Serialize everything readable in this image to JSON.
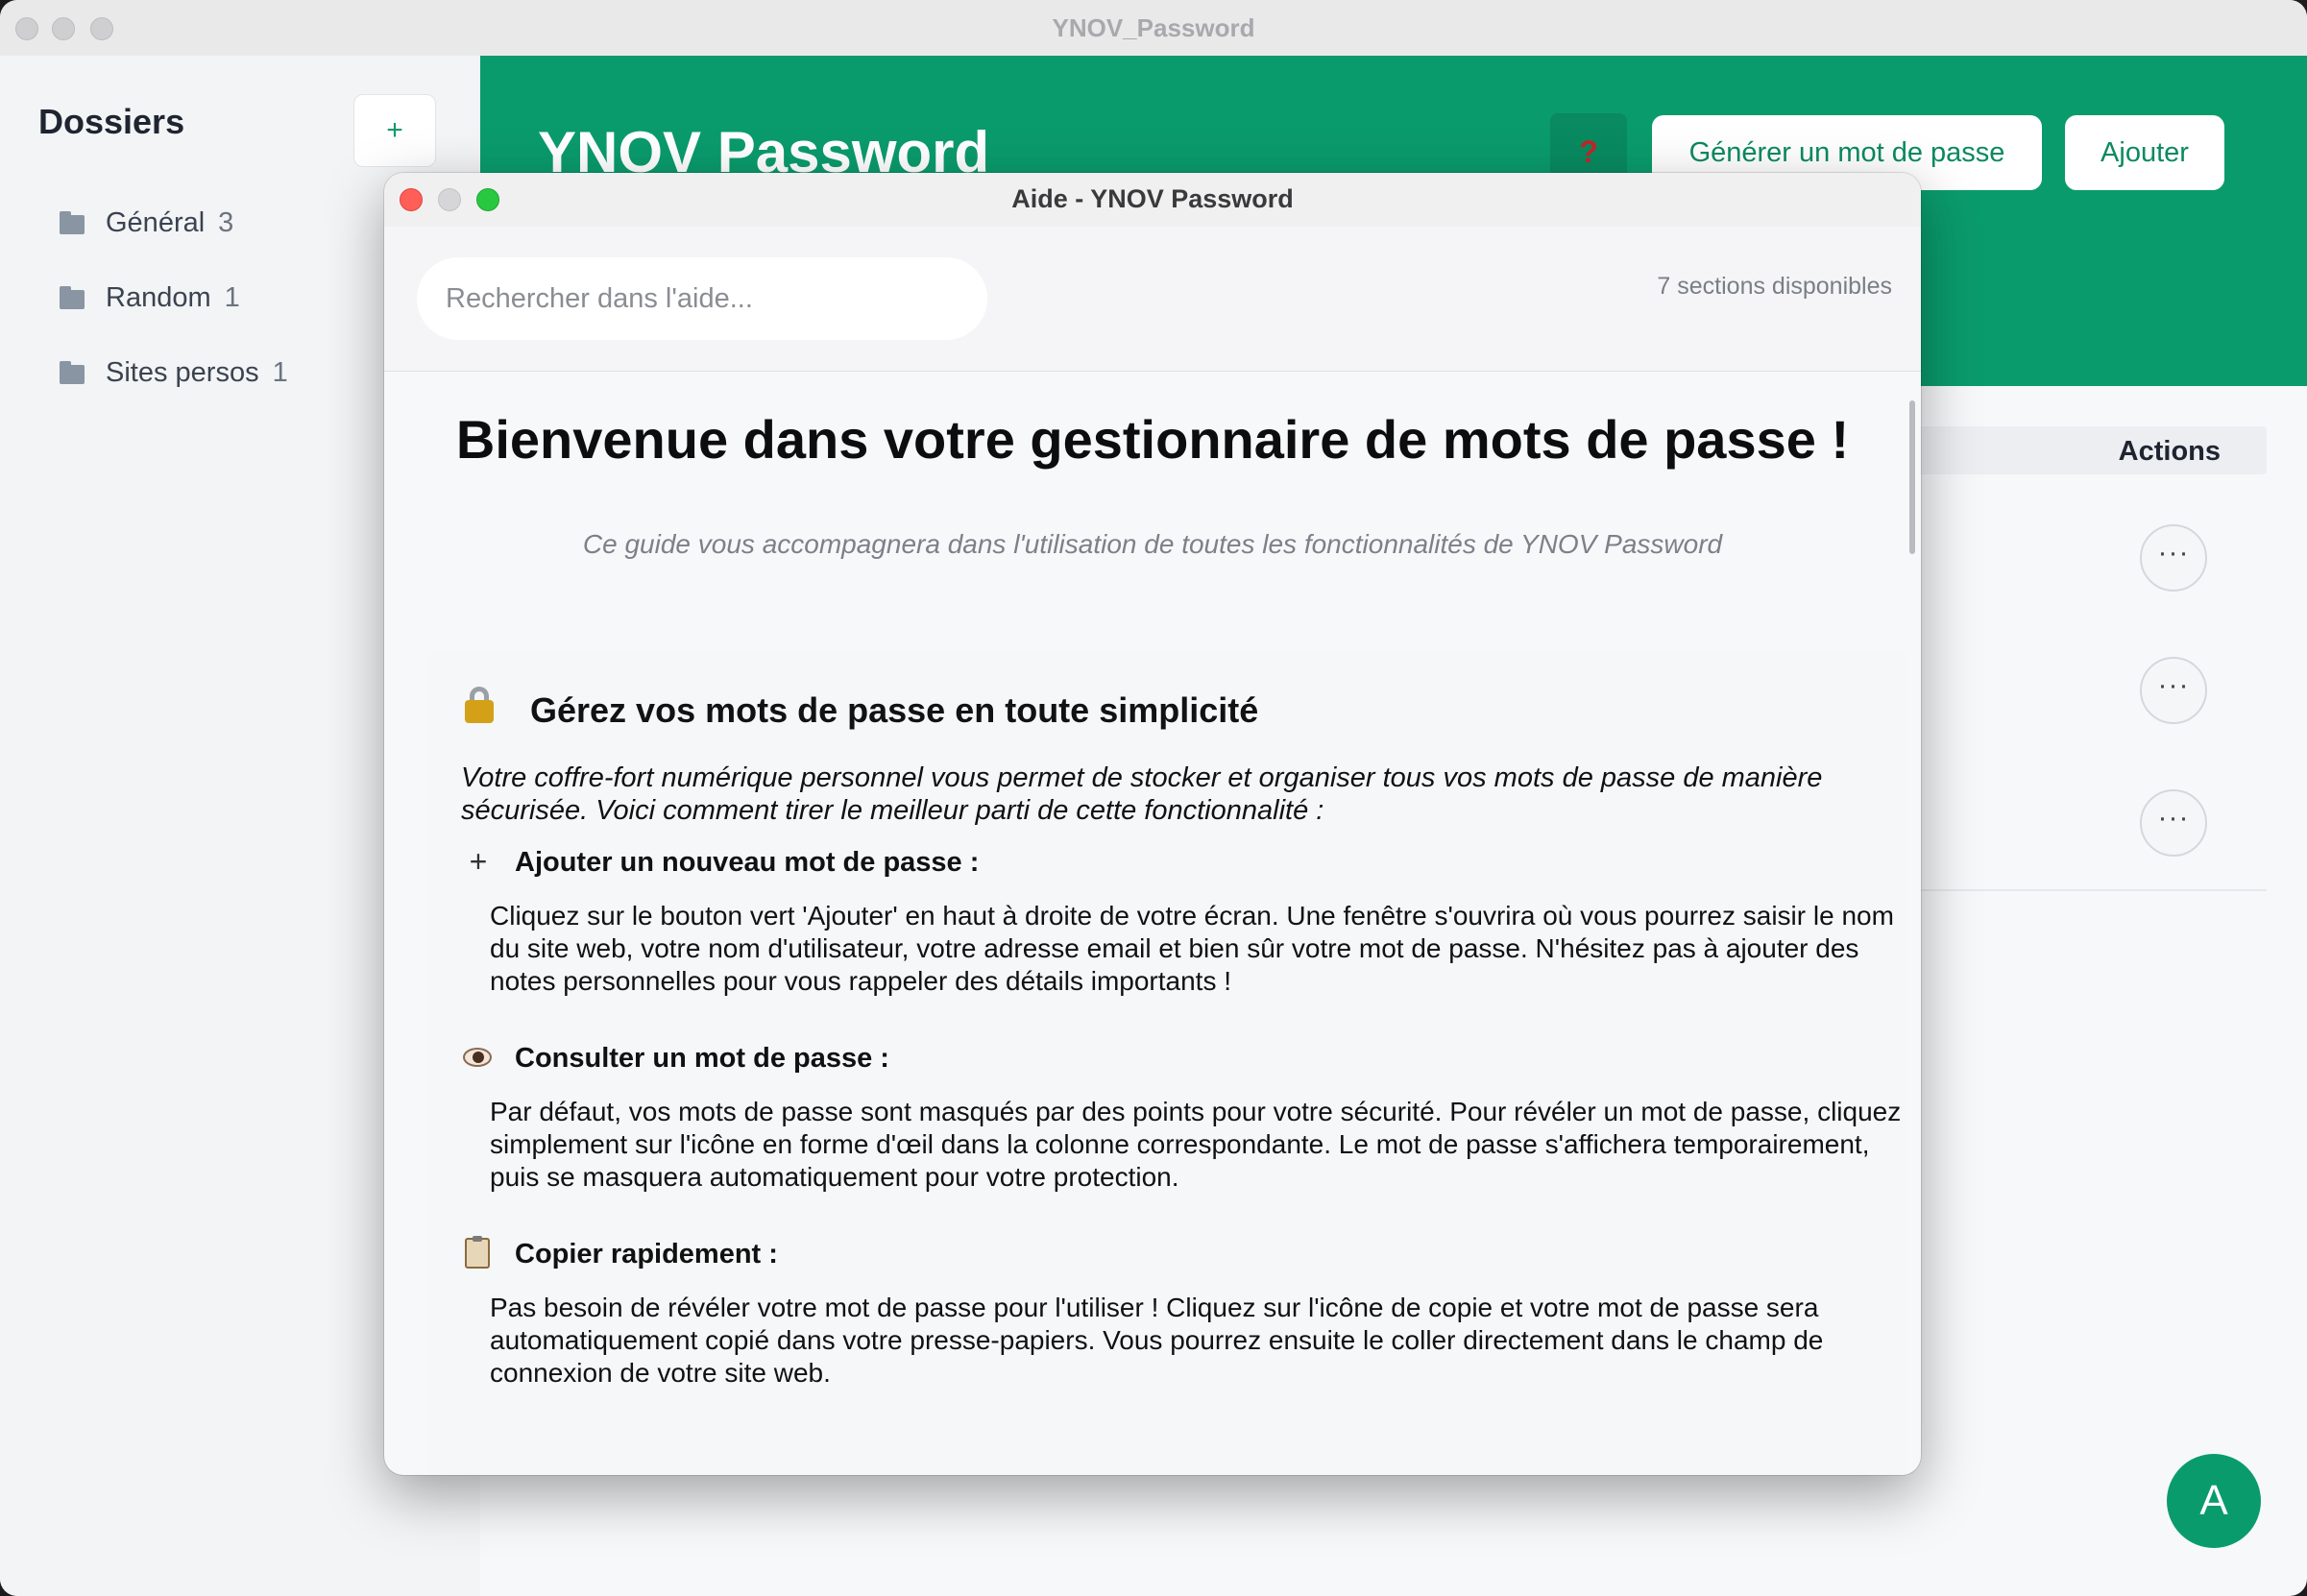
{
  "main_window": {
    "title": "YNOV_Password",
    "sidebar": {
      "title": "Dossiers",
      "add_label": "+",
      "folders": [
        {
          "name": "Général",
          "count": "3"
        },
        {
          "name": "Random",
          "count": "1"
        },
        {
          "name": "Sites persos",
          "count": "1"
        }
      ]
    },
    "header": {
      "app_title": "YNOV Password",
      "help_label": "?",
      "generate_label": "Générer un mot de passe",
      "add_label": "Ajouter"
    },
    "table": {
      "actions_header": "Actions",
      "row_menu_label": "···"
    },
    "avatar_initial": "A",
    "colors": {
      "brand_green": "#0a9b6c",
      "help_red": "#c0262a"
    }
  },
  "help_dialog": {
    "title": "Aide - YNOV Password",
    "search_placeholder": "Rechercher dans l'aide...",
    "sections_count": "7 sections disponibles",
    "welcome_title": "Bienvenue dans votre gestionnaire de mots de passe !",
    "welcome_subtitle": "Ce guide vous accompagnera dans l'utilisation de toutes les fonctionnalités de YNOV Password",
    "section": {
      "icon": "lock-icon",
      "title": "Gérez vos mots de passe en toute simplicité",
      "intro": "Votre coffre-fort numérique personnel vous permet de stocker et organiser tous vos mots de passe de manière sécurisée. Voici comment tirer le meilleur parti de cette fonctionnalité :",
      "items": [
        {
          "icon": "plus-icon",
          "title": "Ajouter un nouveau mot de passe :",
          "body": "Cliquez sur le bouton vert 'Ajouter' en haut à droite de votre écran. Une fenêtre s'ouvrira où vous pourrez saisir le nom du site web, votre nom d'utilisateur, votre adresse email et bien sûr votre mot de passe. N'hésitez pas à ajouter des notes personnelles pour vous rappeler des détails importants !"
        },
        {
          "icon": "eye-icon",
          "title": "Consulter un mot de passe :",
          "body": "Par défaut, vos mots de passe sont masqués par des points pour votre sécurité. Pour révéler un mot de passe, cliquez simplement sur l'icône en forme d'œil dans la colonne correspondante. Le mot de passe s'affichera temporairement, puis se masquera automatiquement pour votre protection."
        },
        {
          "icon": "clipboard-icon",
          "title": "Copier rapidement :",
          "body": "Pas besoin de révéler votre mot de passe pour l'utiliser ! Cliquez sur l'icône de copie et votre mot de passe sera automatiquement copié dans votre presse-papiers. Vous pourrez ensuite le coller directement dans le champ de connexion de votre site web."
        }
      ]
    }
  }
}
